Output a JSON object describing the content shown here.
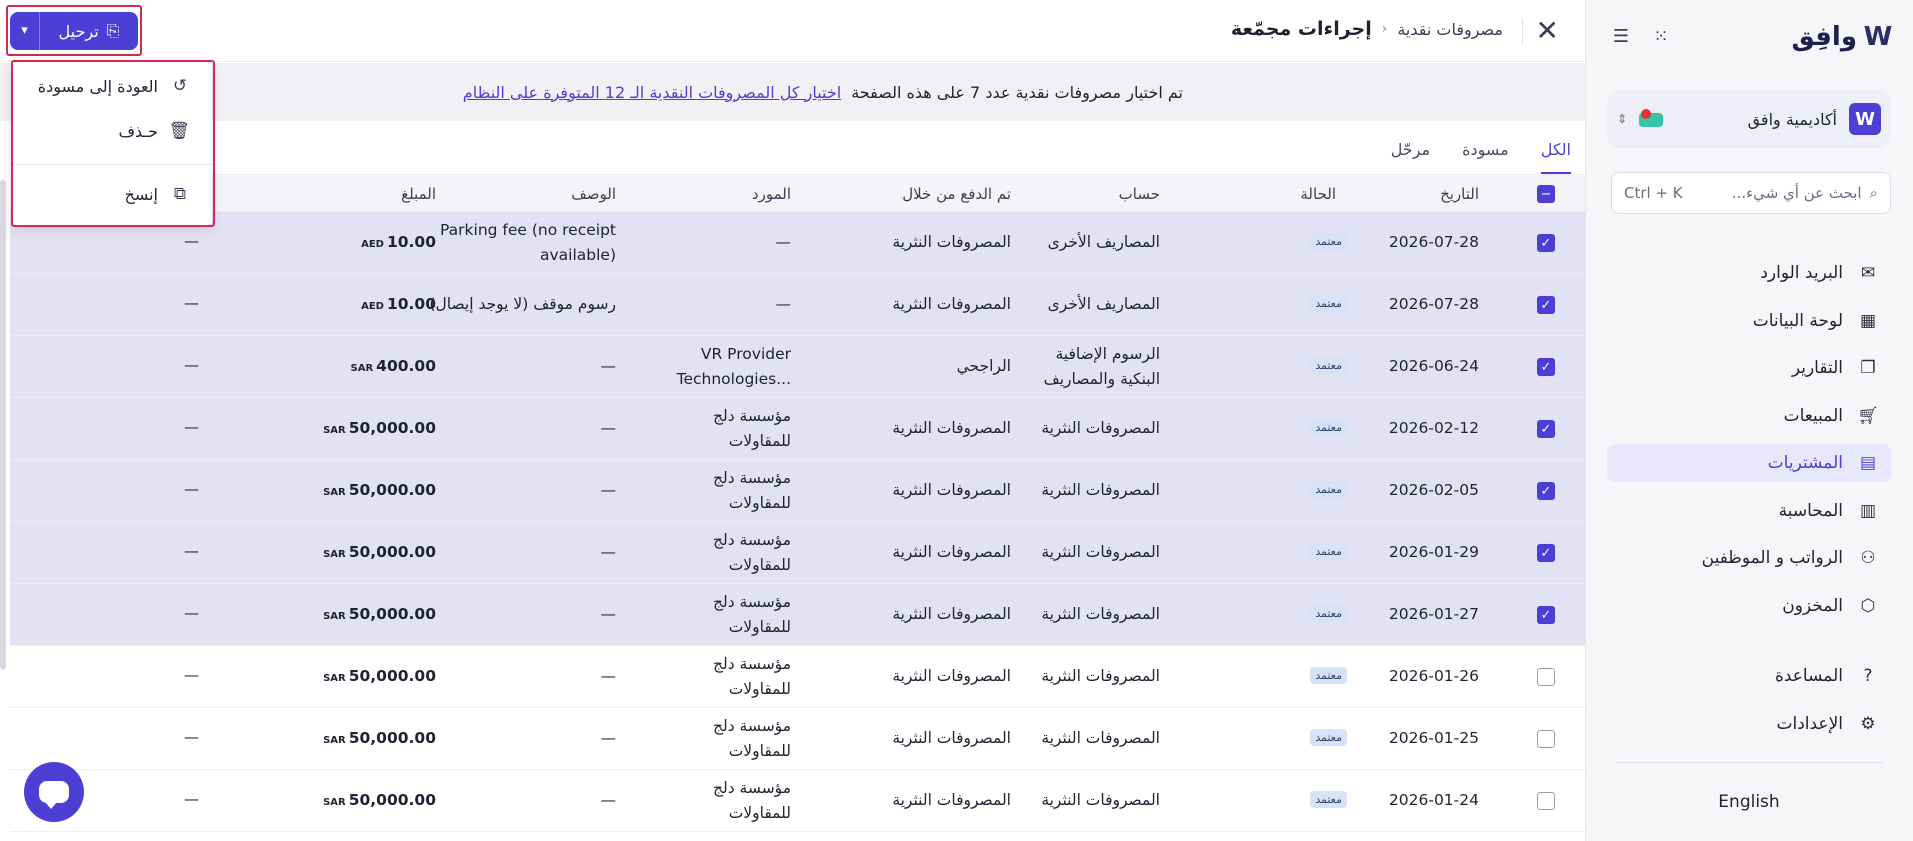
{
  "sidebar": {
    "logo_text": "وافِق",
    "org_name": "أكاديمية وافق",
    "search_placeholder": "ابحث عن أي شيء...",
    "search_shortcut": "Ctrl + K",
    "items": [
      {
        "label": "البريد الوارد",
        "icon": "inbox-icon"
      },
      {
        "label": "لوحة البيانات",
        "icon": "dashboard-icon"
      },
      {
        "label": "التقارير",
        "icon": "reports-icon"
      },
      {
        "label": "المبيعات",
        "icon": "cart-icon"
      },
      {
        "label": "المشتريات",
        "icon": "receipt-icon",
        "active": true
      },
      {
        "label": "المحاسبة",
        "icon": "ledger-icon"
      },
      {
        "label": "الرواتب و الموظفين",
        "icon": "users-icon"
      },
      {
        "label": "المخزون",
        "icon": "box-icon"
      }
    ],
    "bottom_items": [
      {
        "label": "المساعدة",
        "icon": "help-icon"
      },
      {
        "label": "الإعدادات",
        "icon": "gear-icon"
      }
    ],
    "language": "English"
  },
  "header": {
    "breadcrumb_parent": "مصروفات نقدية",
    "title": "إجراءات مجمّعة",
    "post_button": "ترحيل"
  },
  "dropdown": {
    "items": [
      {
        "label": "العودة إلى مسودة",
        "icon": "revert-icon"
      },
      {
        "label": "حـذف",
        "icon": "trash-icon"
      },
      {
        "label": "إنسخ",
        "icon": "copy-icon"
      }
    ]
  },
  "banner": {
    "message": "تم اختيار مصروفات نقدية عدد 7 على هذه الصفحة",
    "link": "اختيار كل المصروفات النقدية الـ 12 المتوفرة على النظام"
  },
  "tabs": [
    {
      "label": "الكل",
      "active": true
    },
    {
      "label": "مسودة",
      "active": false
    },
    {
      "label": "مرحّل",
      "active": false
    }
  ],
  "table": {
    "headers": {
      "date": "التاريخ",
      "status": "الحالة",
      "account": "حساب",
      "paid_through": "تم الدفع من خلال",
      "vendor": "المورد",
      "description": "الوصف",
      "amount": "المبلغ"
    },
    "rows": [
      {
        "selected": true,
        "date": "2026-07-28",
        "status": "معتمد",
        "account": [
          "المصاريف الأخرى"
        ],
        "paid_through": "المصروفات النثرية",
        "vendor": [
          "—"
        ],
        "description": [
          "Parking fee (no receipt",
          "available)"
        ],
        "amount": "10.00",
        "currency": "AED",
        "extra": "—"
      },
      {
        "selected": true,
        "date": "2026-07-28",
        "status": "معتمد",
        "account": [
          "المصاريف الأخرى"
        ],
        "paid_through": "المصروفات النثرية",
        "vendor": [
          "—"
        ],
        "description": [
          "رسوم موقف (لا يوجد إيصال)"
        ],
        "amount": "10.00",
        "currency": "AED",
        "extra": "—"
      },
      {
        "selected": true,
        "date": "2026-06-24",
        "status": "معتمد",
        "account": [
          "الرسوم الإضافية",
          "البنكية والمصاريف"
        ],
        "paid_through": "الراجحي",
        "vendor": [
          "VR Provider",
          "Technologies..."
        ],
        "description": [
          "—"
        ],
        "amount": "400.00",
        "currency": "SAR",
        "extra": "—"
      },
      {
        "selected": true,
        "date": "2026-02-12",
        "status": "معتمد",
        "account": [
          "المصروفات النثرية"
        ],
        "paid_through": "المصروفات النثرية",
        "vendor": [
          "مؤسسة دلج",
          "للمقاولات"
        ],
        "description": [
          "—"
        ],
        "amount": "50,000.00",
        "currency": "SAR",
        "extra": "—"
      },
      {
        "selected": true,
        "date": "2026-02-05",
        "status": "معتمد",
        "account": [
          "المصروفات النثرية"
        ],
        "paid_through": "المصروفات النثرية",
        "vendor": [
          "مؤسسة دلج",
          "للمقاولات"
        ],
        "description": [
          "—"
        ],
        "amount": "50,000.00",
        "currency": "SAR",
        "extra": "—"
      },
      {
        "selected": true,
        "date": "2026-01-29",
        "status": "معتمد",
        "account": [
          "المصروفات النثرية"
        ],
        "paid_through": "المصروفات النثرية",
        "vendor": [
          "مؤسسة دلج",
          "للمقاولات"
        ],
        "description": [
          "—"
        ],
        "amount": "50,000.00",
        "currency": "SAR",
        "extra": "—"
      },
      {
        "selected": true,
        "date": "2026-01-27",
        "status": "معتمد",
        "account": [
          "المصروفات النثرية"
        ],
        "paid_through": "المصروفات النثرية",
        "vendor": [
          "مؤسسة دلج",
          "للمقاولات"
        ],
        "description": [
          "—"
        ],
        "amount": "50,000.00",
        "currency": "SAR",
        "extra": "—"
      },
      {
        "selected": false,
        "date": "2026-01-26",
        "status": "معتمد",
        "account": [
          "المصروفات النثرية"
        ],
        "paid_through": "المصروفات النثرية",
        "vendor": [
          "مؤسسة دلج",
          "للمقاولات"
        ],
        "description": [
          "—"
        ],
        "amount": "50,000.00",
        "currency": "SAR",
        "extra": "—"
      },
      {
        "selected": false,
        "date": "2026-01-25",
        "status": "معتمد",
        "account": [
          "المصروفات النثرية"
        ],
        "paid_through": "المصروفات النثرية",
        "vendor": [
          "مؤسسة دلج",
          "للمقاولات"
        ],
        "description": [
          "—"
        ],
        "amount": "50,000.00",
        "currency": "SAR",
        "extra": "—"
      },
      {
        "selected": false,
        "date": "2026-01-24",
        "status": "معتمد",
        "account": [
          "المصروفات النثرية"
        ],
        "paid_through": "المصروفات النثرية",
        "vendor": [
          "مؤسسة دلج",
          "للمقاولات"
        ],
        "description": [
          "—"
        ],
        "amount": "50,000.00",
        "currency": "SAR",
        "extra": "—"
      }
    ],
    "partial_row_vendor": "مؤسسة دلج"
  },
  "colors": {
    "accent": "#4b3fd6",
    "selected_row": "#e3e1f4",
    "highlight_box": "#d0295a"
  }
}
